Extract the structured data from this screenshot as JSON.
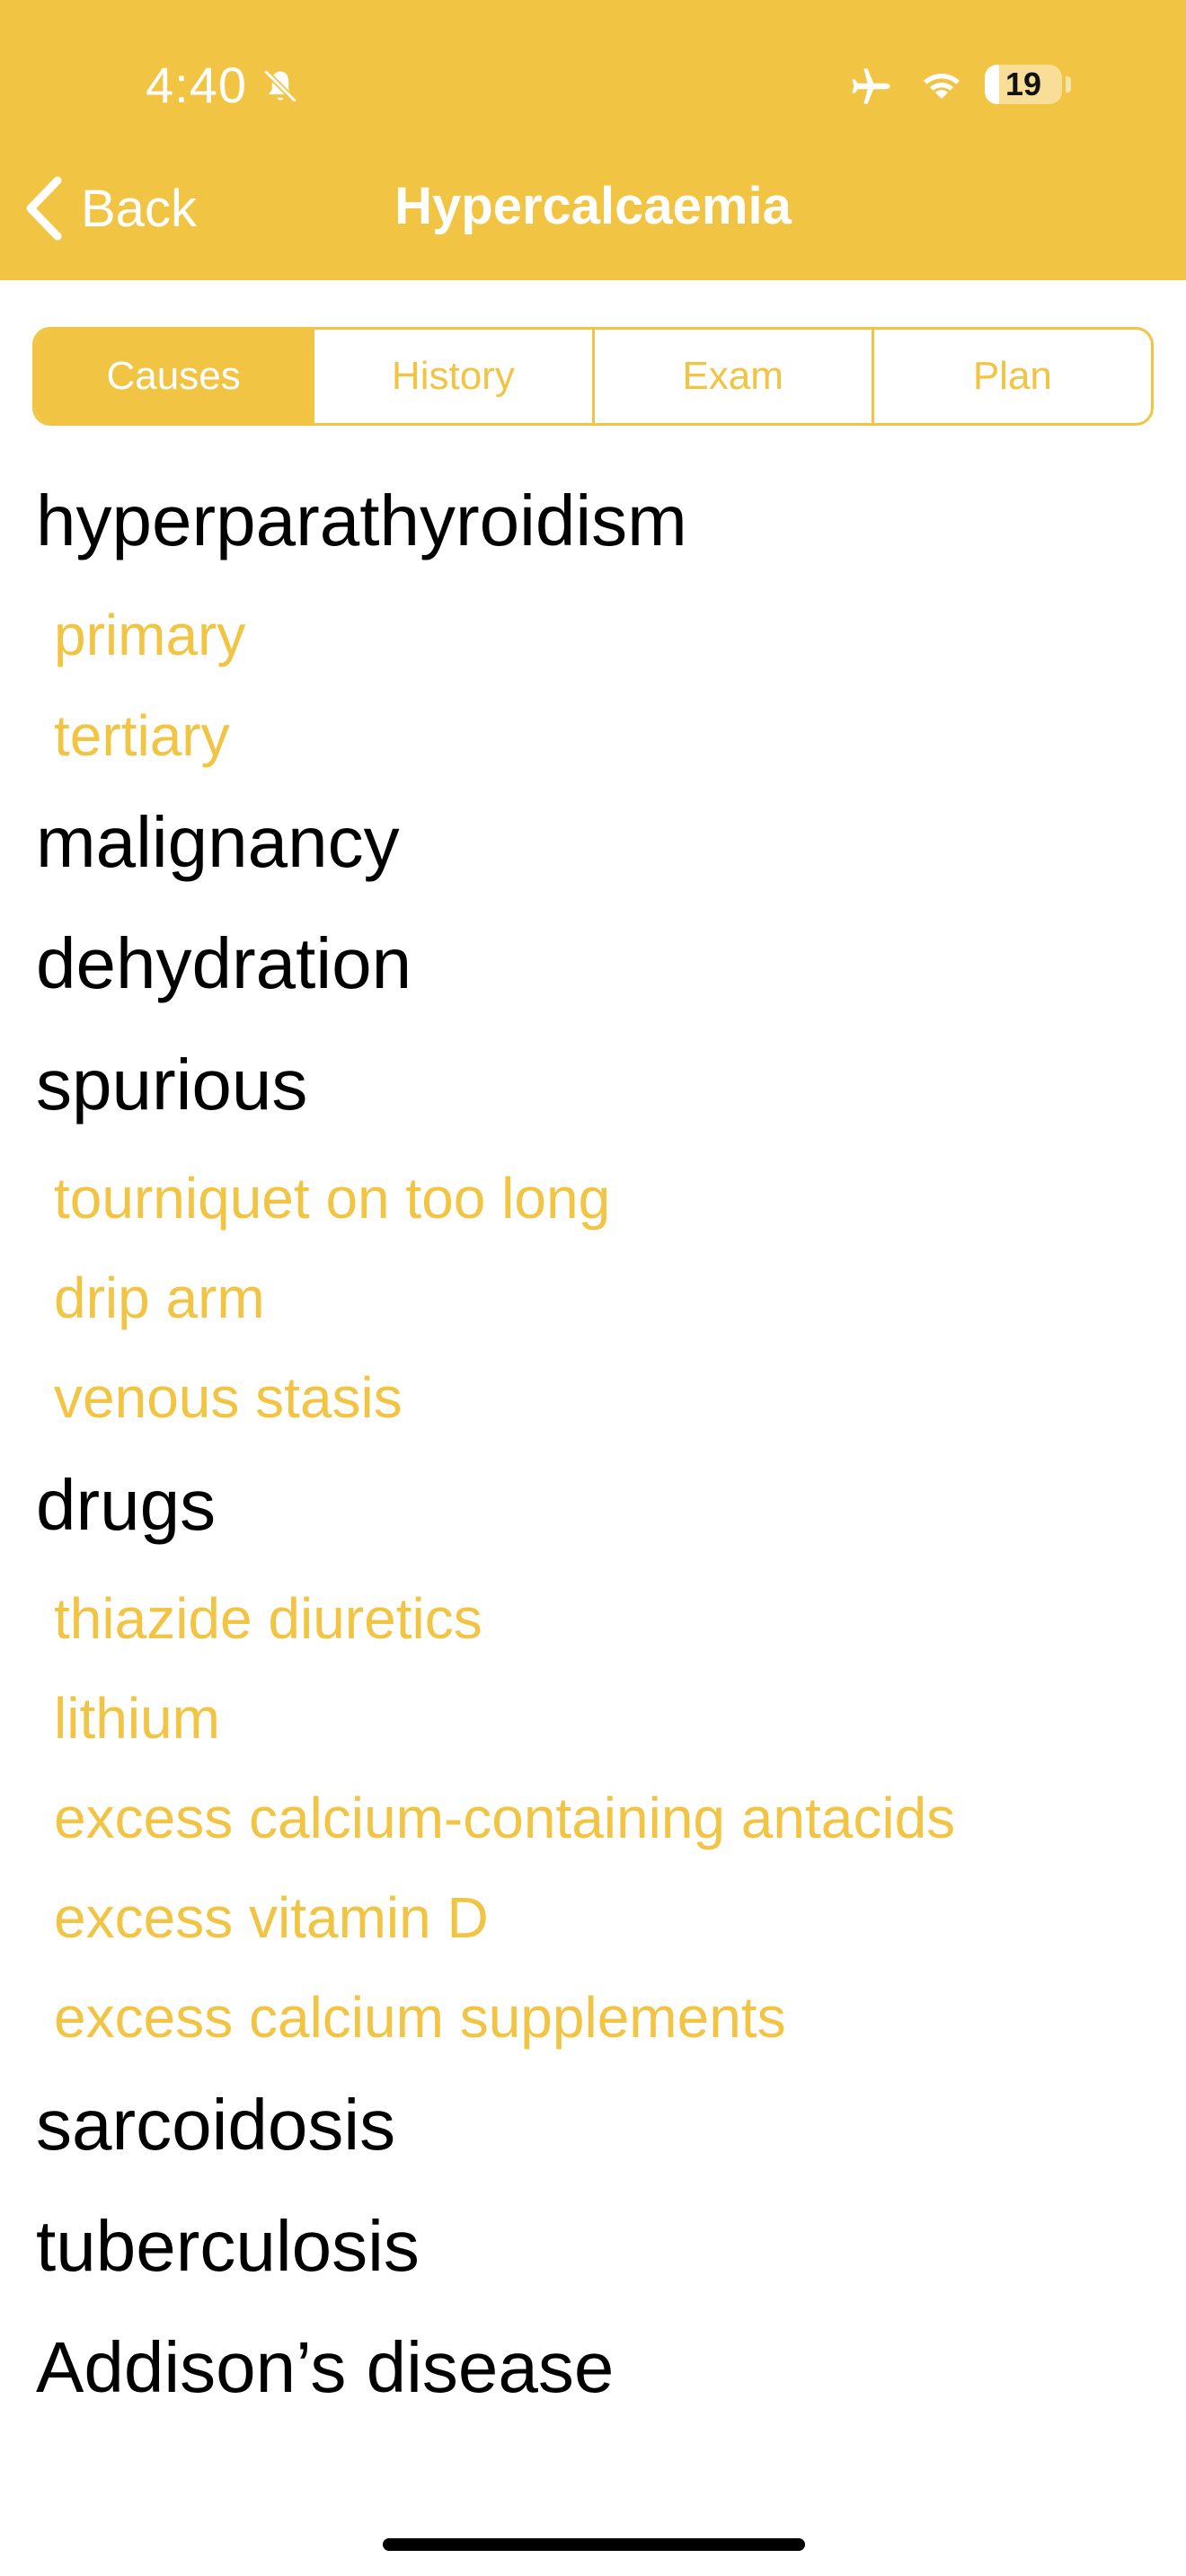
{
  "status_bar": {
    "time": "4:40",
    "battery": "19",
    "battery_level": 0.19,
    "icons": [
      "bell-slash-icon",
      "airplane-icon",
      "wifi-icon"
    ]
  },
  "nav": {
    "back_label": "Back",
    "title": "Hypercalcaemia"
  },
  "tabs": [
    {
      "label": "Causes",
      "active": true
    },
    {
      "label": "History",
      "active": false
    },
    {
      "label": "Exam",
      "active": false
    },
    {
      "label": "Plan",
      "active": false
    }
  ],
  "items": [
    {
      "text": "hyperparathyroidism",
      "level": 0
    },
    {
      "text": "primary",
      "level": 1
    },
    {
      "text": "tertiary",
      "level": 1
    },
    {
      "text": "malignancy",
      "level": 0
    },
    {
      "text": "dehydration",
      "level": 0
    },
    {
      "text": "spurious",
      "level": 0
    },
    {
      "text": "tourniquet on too long",
      "level": 1
    },
    {
      "text": "drip arm",
      "level": 1
    },
    {
      "text": "venous stasis",
      "level": 1
    },
    {
      "text": "drugs",
      "level": 0
    },
    {
      "text": "thiazide diuretics",
      "level": 1
    },
    {
      "text": "lithium",
      "level": 1
    },
    {
      "text": "excess calcium-containing antacids",
      "level": 1
    },
    {
      "text": "excess vitamin D",
      "level": 1
    },
    {
      "text": "excess calcium supplements",
      "level": 1
    },
    {
      "text": "sarcoidosis",
      "level": 0
    },
    {
      "text": "tuberculosis",
      "level": 0
    },
    {
      "text": "Addison’s disease",
      "level": 0
    }
  ],
  "colors": {
    "accent": "#F2C443",
    "text": "#000000",
    "background": "#FFFFFF"
  }
}
